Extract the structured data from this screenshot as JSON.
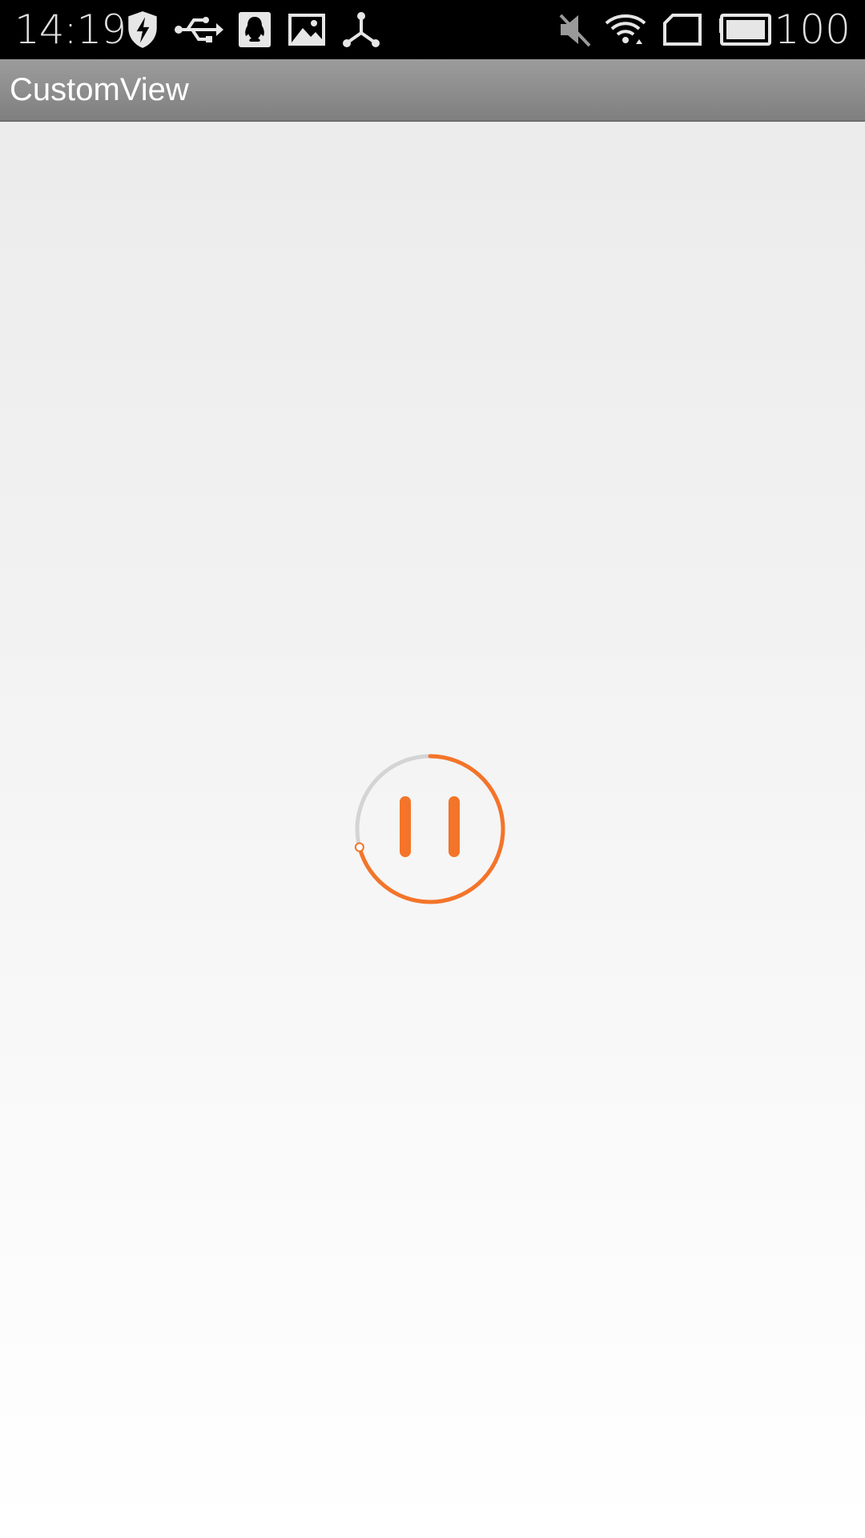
{
  "status_bar": {
    "time": "14:19",
    "battery_level": "100",
    "icons_left": [
      "shield-bolt-icon",
      "usb-icon",
      "qq-penguin-icon",
      "image-icon",
      "share-nodes-icon"
    ],
    "icons_right": [
      "mute-icon",
      "wifi-icon",
      "sim-card-icon",
      "battery-icon"
    ]
  },
  "action_bar": {
    "title": "CustomView"
  },
  "player": {
    "state": "playing",
    "control_icon": "pause-icon",
    "progress_fraction": 0.71,
    "colors": {
      "accent": "#f47429",
      "track": "#d3d4d6"
    }
  }
}
